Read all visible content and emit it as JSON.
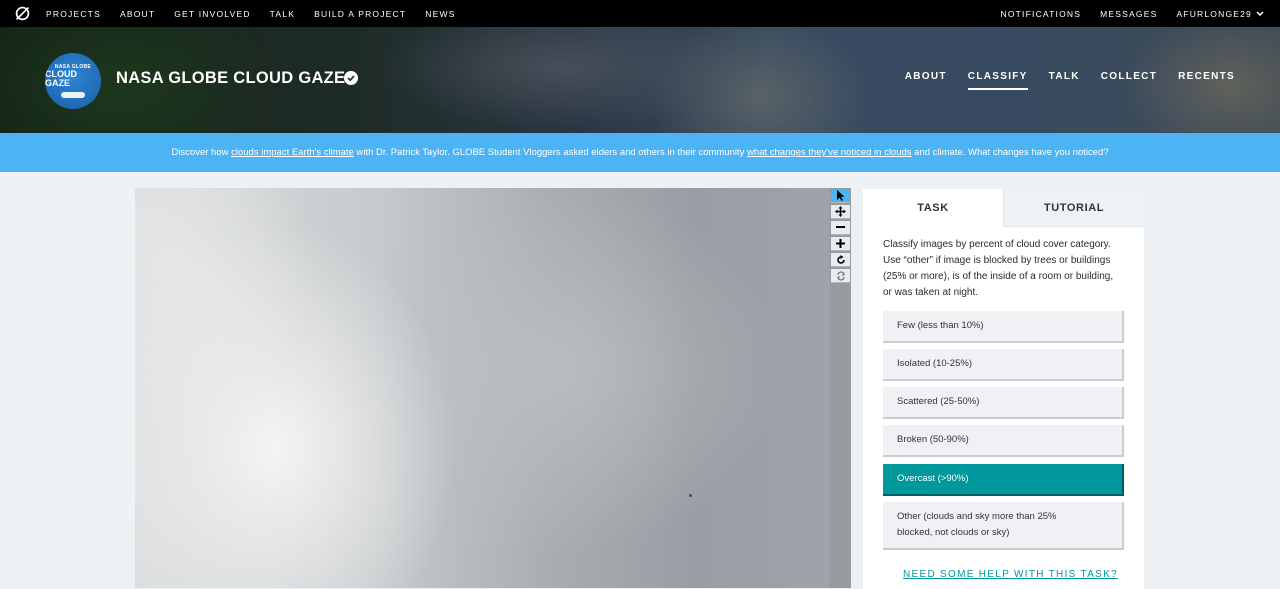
{
  "top_nav": {
    "logo_icon": "zooniverse-logo-icon",
    "items": [
      "PROJECTS",
      "ABOUT",
      "GET INVOLVED",
      "TALK",
      "BUILD A PROJECT",
      "NEWS"
    ],
    "notifications": "NOTIFICATIONS",
    "messages": "MESSAGES",
    "username": "AFURLONGE29"
  },
  "project": {
    "avatar_text_top": "NASA GLOBE",
    "avatar_text_bottom": "CLOUD GAZE",
    "title": "NASA GLOBE CLOUD GAZE",
    "nav": [
      "ABOUT",
      "CLASSIFY",
      "TALK",
      "COLLECT",
      "RECENTS"
    ],
    "active_nav": "CLASSIFY"
  },
  "announcement": {
    "part1": "Discover how ",
    "link1": "clouds impact Earth's climate",
    "part2": " with Dr. Patrick Taylor. GLOBE Student Vloggers asked elders and others in their community ",
    "link2": "what changes they've noticed in clouds",
    "part3": " and climate. What changes have you noticed?"
  },
  "toolbar": {
    "tools": [
      "pointer-icon",
      "move-icon",
      "zoom-out-icon",
      "zoom-in-icon",
      "rotate-icon",
      "reset-icon"
    ]
  },
  "task_panel": {
    "tabs": [
      "TASK",
      "TUTORIAL"
    ],
    "instructions": "Classify images by percent of cloud cover category. Use “other” if image is blocked by trees or buildings (25% or more), is of the inside of a room or building, or was taken at night.",
    "answers": [
      "Few (less than 10%)",
      "Isolated (10-25%)",
      "Scattered (25-50%)",
      "Broken (50-90%)",
      "Overcast (>90%)",
      "Other (clouds and sky more than 25% blocked, not clouds or sky)"
    ],
    "selected_answer": "Overcast (>90%)",
    "help_link": "NEED SOME HELP WITH THIS TASK?"
  },
  "colors": {
    "accent_blue": "#4cb3f5",
    "selected_teal": "#00979d",
    "nav_black": "#000000"
  }
}
